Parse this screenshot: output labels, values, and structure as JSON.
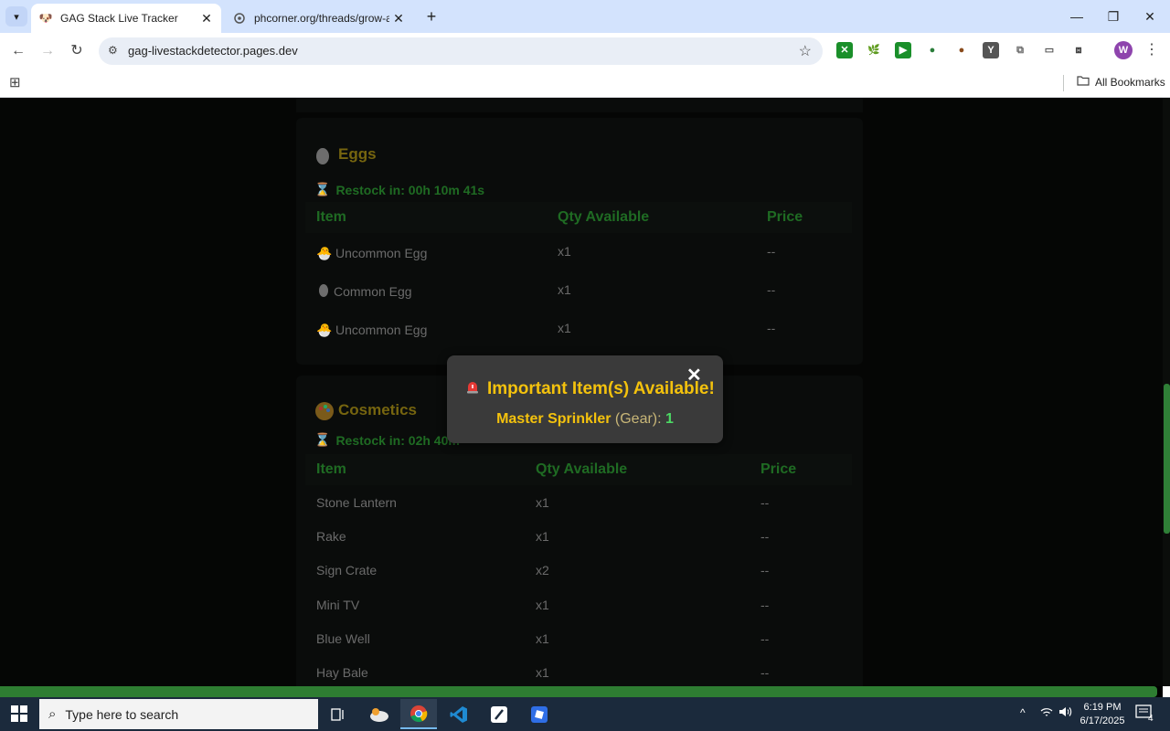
{
  "browser": {
    "tabs": [
      {
        "title": "GAG Stack Live Tracker",
        "active": true
      },
      {
        "title": "phcorner.org/threads/grow-a-g",
        "active": false
      }
    ],
    "url": "gag-livestackdetector.pages.dev",
    "profile_initial": "W",
    "bookmarks_label": "All Bookmarks"
  },
  "eggs": {
    "title": "Eggs",
    "restock": "Restock in: 00h 10m 41s",
    "columns": [
      "Item",
      "Qty Available",
      "Price"
    ],
    "rows": [
      {
        "icon": "uncommon-egg-icon",
        "name": "Uncommon Egg",
        "qty": "x1",
        "price": "--"
      },
      {
        "icon": "common-egg-icon",
        "name": "Common Egg",
        "qty": "x1",
        "price": "--"
      },
      {
        "icon": "uncommon-egg-icon",
        "name": "Uncommon Egg",
        "qty": "x1",
        "price": "--"
      }
    ]
  },
  "cosmetics": {
    "title": "Cosmetics",
    "restock": "Restock in: 02h 40m",
    "columns": [
      "Item",
      "Qty Available",
      "Price"
    ],
    "rows": [
      {
        "name": "Stone Lantern",
        "qty": "x1",
        "price": "--"
      },
      {
        "name": "Rake",
        "qty": "x1",
        "price": "--"
      },
      {
        "name": "Sign Crate",
        "qty": "x2",
        "price": "--"
      },
      {
        "name": "Mini TV",
        "qty": "x1",
        "price": "--"
      },
      {
        "name": "Blue Well",
        "qty": "x1",
        "price": "--"
      },
      {
        "name": "Hay Bale",
        "qty": "x1",
        "price": "--"
      }
    ]
  },
  "modal": {
    "close": "✕",
    "title": "Important Item(s) Available!",
    "item": "Master Sprinkler",
    "category": "(Gear):",
    "count": "1"
  },
  "taskbar": {
    "search_placeholder": "Type here to search",
    "time": "6:19 PM",
    "date": "6/17/2025",
    "notification_count": "4"
  },
  "colors": {
    "accent_gold": "#f4c20d",
    "section_green": "#1f6b23",
    "progress_green": "#2e7d32"
  }
}
